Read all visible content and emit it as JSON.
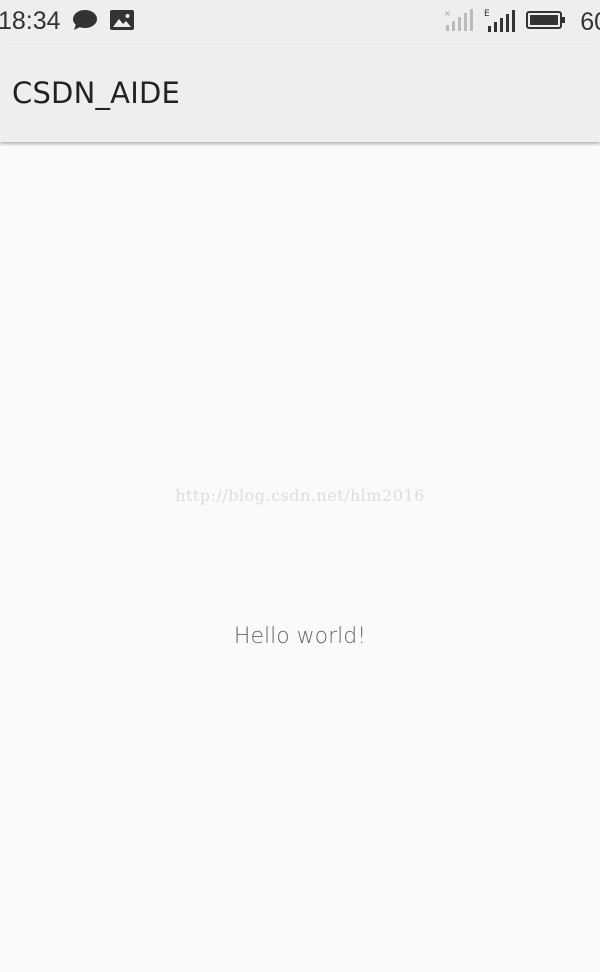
{
  "status_bar": {
    "time": "18:34",
    "battery_level": "60",
    "network_type": "E",
    "icons": [
      "chat-bubble-icon",
      "image-icon",
      "signal-no-sim-icon",
      "signal-icon",
      "battery-icon"
    ]
  },
  "app_bar": {
    "title": "CSDN_AIDE"
  },
  "main": {
    "text": "Hello world!"
  },
  "watermark": "http://blog.csdn.net/hlm2016",
  "colors": {
    "background": "#fafafa",
    "app_bar": "#eeeeee",
    "status_bar": "#eeeeee",
    "text_primary": "#222222",
    "text_secondary": "#666666"
  }
}
